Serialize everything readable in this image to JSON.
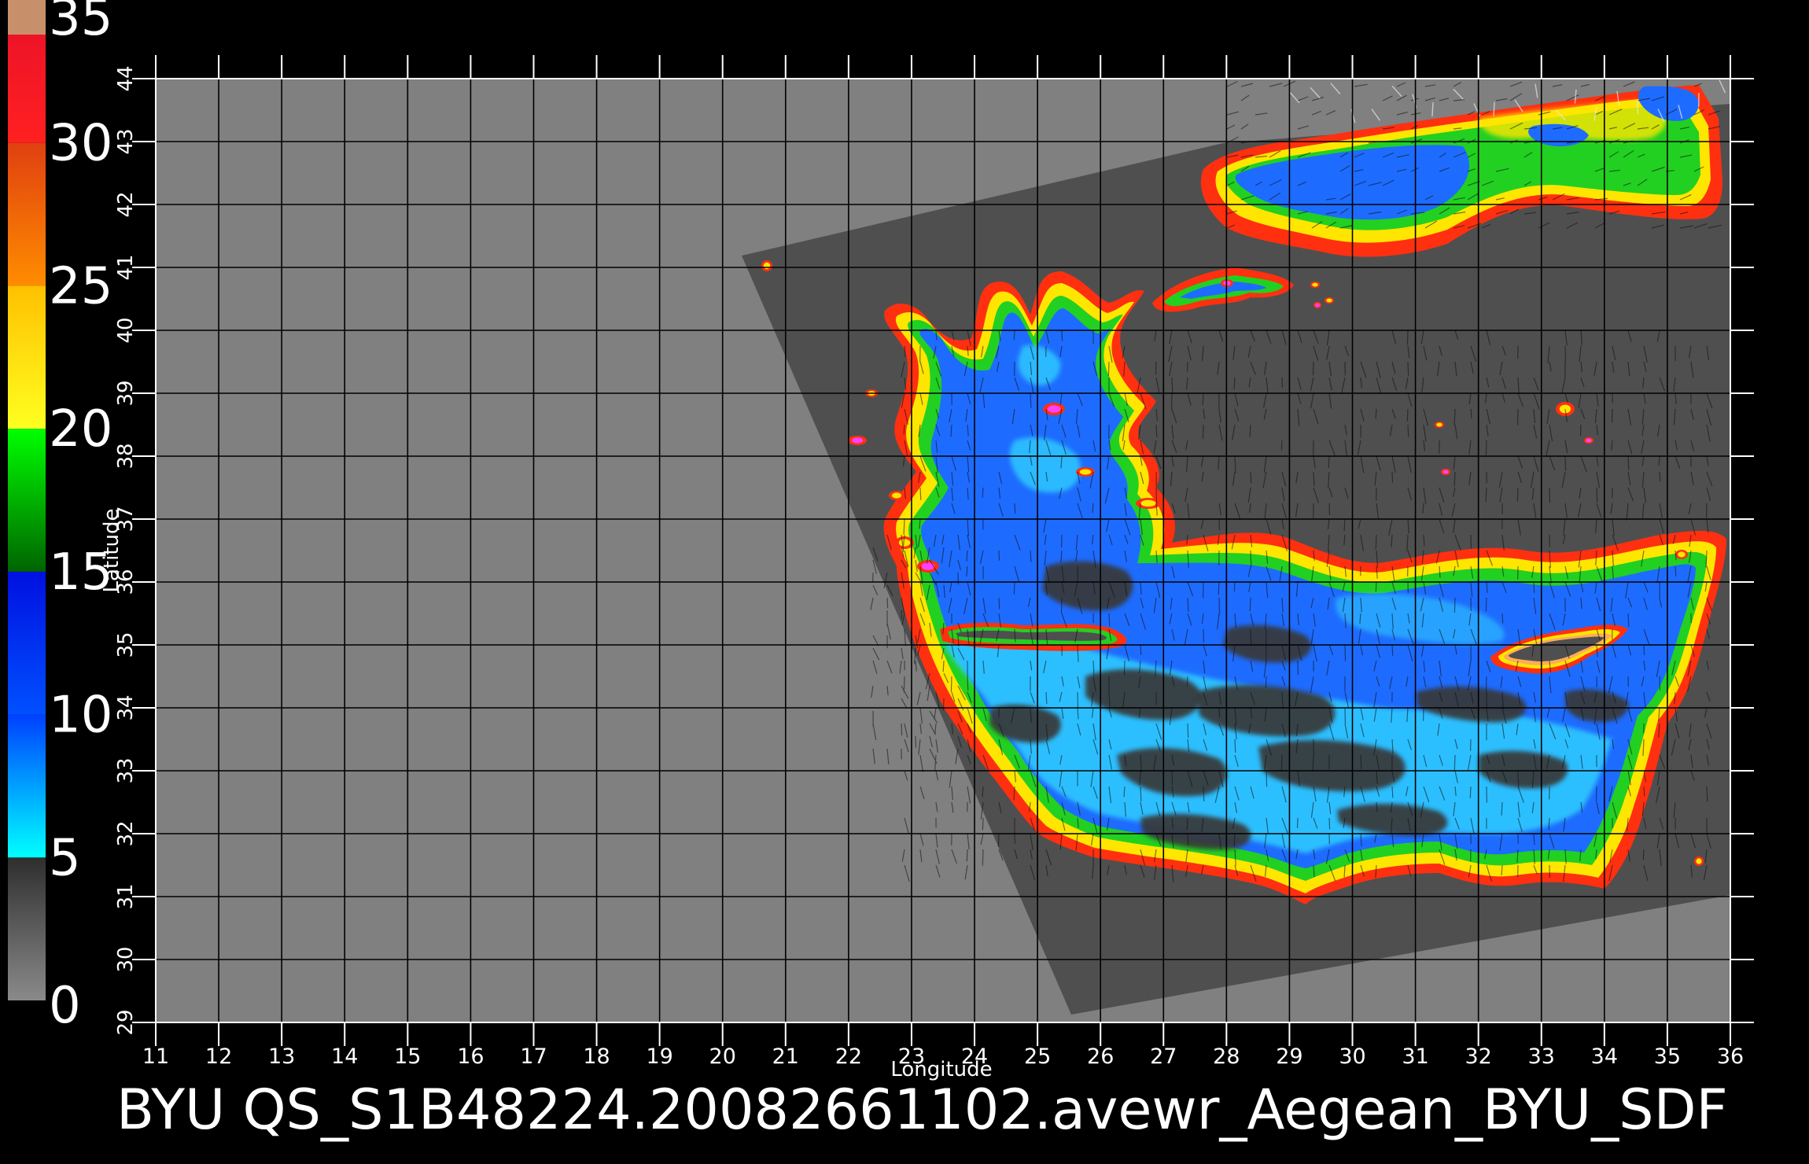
{
  "colorbar": {
    "ticks": [
      "0",
      "5",
      "10",
      "15",
      "20",
      "25",
      "30",
      "35"
    ],
    "values": [
      0,
      5,
      10,
      15,
      20,
      25,
      30,
      35
    ],
    "colors": {
      "band_0_5_low": "#8a8a8a",
      "band_0_5_high": "#2e2e2e",
      "band_5_10_low": "#00ffff",
      "band_5_10_high": "#0040ff",
      "band_10_15_low": "#0050ff",
      "band_10_15_high": "#0010e0",
      "band_15_20_low": "#006400",
      "band_15_20_high": "#00ff00",
      "band_20_25_low": "#ffff20",
      "band_20_25_high": "#ffc000",
      "band_25_30_low": "#ff8c00",
      "band_25_30_high": "#e04010",
      "band_30_35_low": "#ff2020",
      "band_30_35_high": "#e8102a",
      "band_top": "#c8906a"
    }
  },
  "map": {
    "lon_range": [
      11,
      36
    ],
    "lat_range": [
      29,
      44
    ],
    "lon_ticks": [
      "11",
      "12",
      "13",
      "14",
      "15",
      "16",
      "17",
      "18",
      "19",
      "20",
      "21",
      "22",
      "23",
      "24",
      "25",
      "26",
      "27",
      "28",
      "29",
      "30",
      "31",
      "32",
      "33",
      "34",
      "35",
      "36"
    ],
    "lat_ticks": [
      "29",
      "30",
      "31",
      "32",
      "33",
      "34",
      "35",
      "36",
      "37",
      "38",
      "39",
      "40",
      "41",
      "42",
      "43",
      "44"
    ],
    "xlabel": "Longitude",
    "ylabel": "Latitude",
    "colors": {
      "background": "#000000",
      "no_data": "#808080",
      "land_swath": "#4f4f4f",
      "grid": "#000000",
      "frame": "#ffffff",
      "sea_blue": "#1e6cff",
      "sea_cyan": "#2ec8ff",
      "coast_green": "#22d022",
      "coast_yellow": "#ffe600",
      "coast_red": "#ff3010",
      "coast_magenta": "#ff40ff",
      "low_wind": "#383838"
    }
  },
  "footer": {
    "title": "BYU  QS_S1B48224.20082661102.avewr_Aegean_BYU_SDF"
  }
}
